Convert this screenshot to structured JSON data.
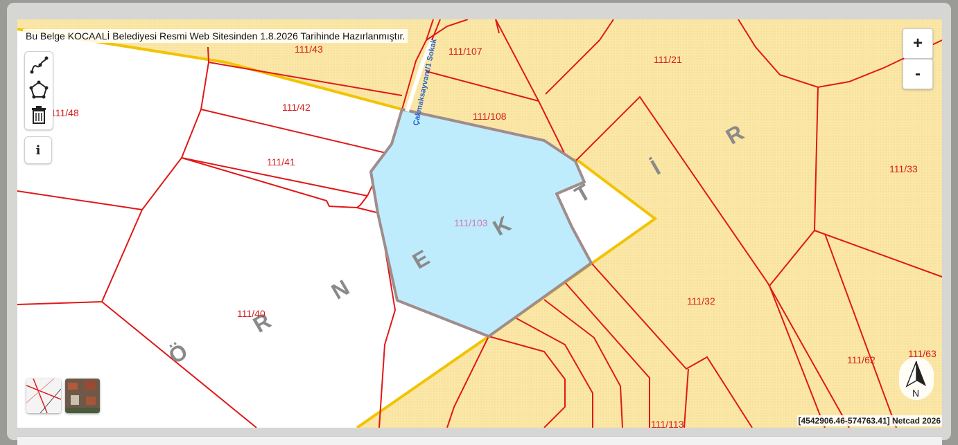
{
  "banner": "Bu Belge KOCAALİ Belediyesi Resmi Web Sitesinden 1.8.2026 Tarihinde Hazırlanmıştır.",
  "zoom": {
    "in": "+",
    "out": "-"
  },
  "tools": {
    "info": "i"
  },
  "icons": [
    "line-draw-icon",
    "polygon-draw-icon",
    "trash-icon",
    "info-icon",
    "north-arrow-icon"
  ],
  "north_label": "N",
  "coordinates": "[4542906.46-574763.41] Netcad 2026",
  "street": "Çakmaksayvant/1 Sokak",
  "neighborhood_letters": [
    "Ö",
    "R",
    "N",
    "E",
    "K",
    "T",
    "İ",
    "R"
  ],
  "parcels": {
    "p43": "111/43",
    "p107": "111/107",
    "p21": "111/21",
    "p48": "111/48",
    "p42": "111/42",
    "p108": "111/108",
    "p41": "111/41",
    "p33": "111/33",
    "p103": "111/103",
    "p32": "111/32",
    "p40": "111/40",
    "p62": "111/62",
    "p63": "111/63",
    "p113": "111/113"
  },
  "colors": {
    "zone_fill": "#fbe7a6",
    "parcel_line": "#e01818",
    "zone_boundary": "#f2c300",
    "selected_fill": "#bfecfc",
    "selected_line": "#a08c8c"
  }
}
